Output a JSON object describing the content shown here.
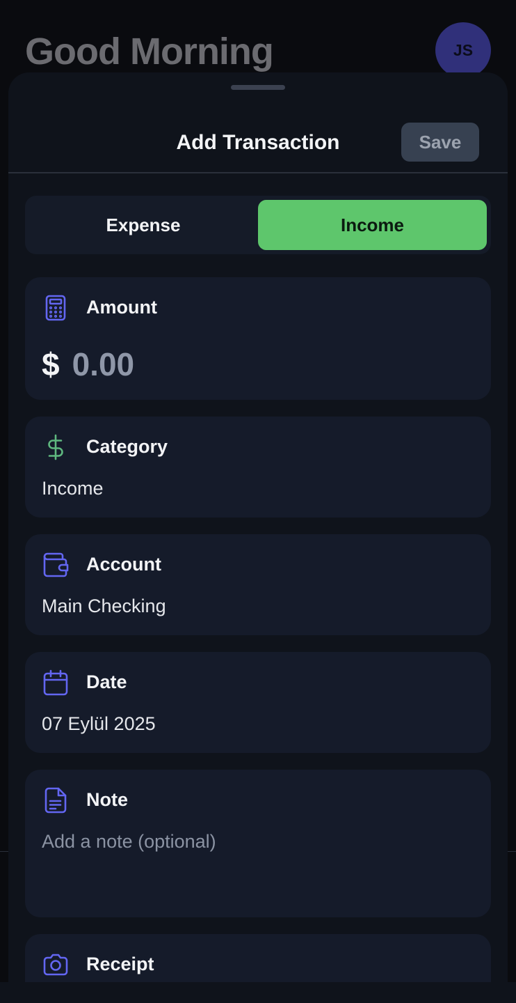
{
  "background": {
    "greeting": "Good Morning",
    "avatar_initials": "JS"
  },
  "sheet": {
    "title": "Add Transaction",
    "save_label": "Save",
    "type_toggle": {
      "options": [
        "Expense",
        "Income"
      ],
      "selected": "Income"
    },
    "amount": {
      "label": "Amount",
      "currency_symbol": "$",
      "placeholder": "0.00"
    },
    "category": {
      "label": "Category",
      "value": "Income"
    },
    "account": {
      "label": "Account",
      "value": "Main Checking"
    },
    "date": {
      "label": "Date",
      "value": "07 Eylül 2025"
    },
    "note": {
      "label": "Note",
      "placeholder": "Add a note (optional)"
    },
    "receipt": {
      "label": "Receipt"
    }
  },
  "icons": {
    "amount": "calculator-icon",
    "category": "dollar-sign-icon",
    "account": "wallet-icon",
    "date": "calendar-icon",
    "note": "document-icon",
    "receipt": "camera-icon"
  },
  "colors": {
    "accent_icon": "#6366f1",
    "income_green": "#5ec66c",
    "category_icon_green": "#5fb87f",
    "card_bg": "#151b2a",
    "sheet_bg": "#0f131b"
  }
}
